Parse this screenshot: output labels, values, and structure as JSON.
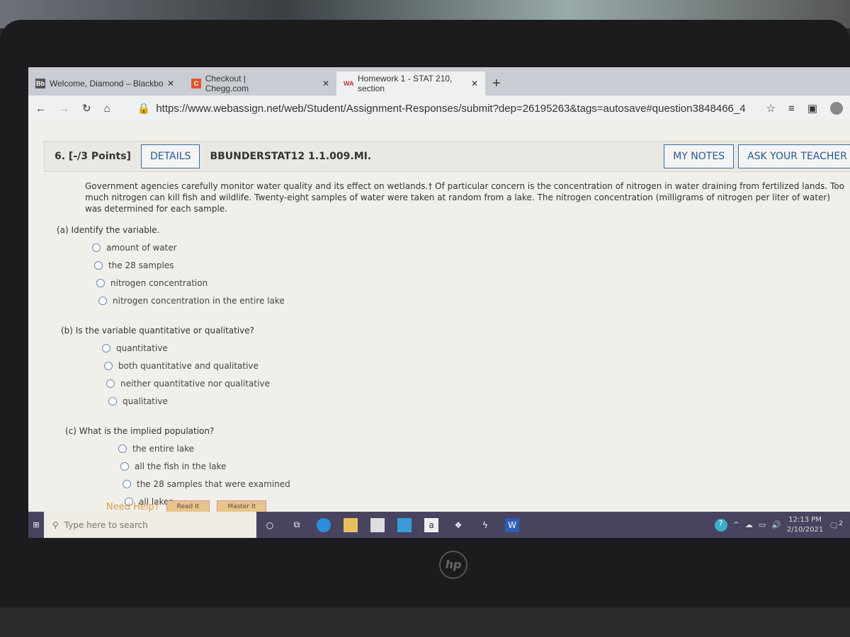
{
  "browser": {
    "tabs": [
      {
        "label": "Welcome, Diamond – Blackboard",
        "icon": "blackboard-icon"
      },
      {
        "label": "Checkout | Chegg.com",
        "icon": "chegg-icon"
      },
      {
        "label": "Homework 1 - STAT 210, section",
        "icon": "webassign-icon"
      }
    ],
    "new_tab": "+",
    "url": "https://www.webassign.net/web/Student/Assignment-Responses/submit?dep=26195263&tags=autosave#question3848466_4"
  },
  "question": {
    "number": "6. [-/3 Points]",
    "details": "DETAILS",
    "code": "BBUNDERSTAT12 1.1.009.MI.",
    "my_notes": "MY NOTES",
    "ask_teacher": "ASK YOUR TEACHER",
    "prompt": "Government agencies carefully monitor water quality and its effect on wetlands.† Of particular concern is the concentration of nitrogen in water draining from fertilized lands. Too much nitrogen can kill fish and wildlife. Twenty-eight samples of water were taken at random from a lake. The nitrogen concentration (milligrams of nitrogen per liter of water) was determined for each sample.",
    "parts": [
      {
        "label": "(a)  Identify the variable.",
        "options": [
          "amount of water",
          "the 28 samples",
          "nitrogen concentration",
          "nitrogen concentration in the entire lake"
        ]
      },
      {
        "label": "(b)  Is the variable quantitative or qualitative?",
        "options": [
          "quantitative",
          "both quantitative and qualitative",
          "neither quantitative nor qualitative",
          "qualitative"
        ]
      },
      {
        "label": "(c)  What is the implied population?",
        "options": [
          "the entire lake",
          "all the fish in the lake",
          "the 28 samples that were examined",
          "all lakes"
        ]
      }
    ],
    "need_help": "Need Help?",
    "read_it": "Read It",
    "master_it": "Master It"
  },
  "taskbar": {
    "search_placeholder": "Type here to search",
    "time": "12:13 PM",
    "date": "2/10/2021",
    "notifications": "2"
  },
  "laptop_logo": "hp"
}
